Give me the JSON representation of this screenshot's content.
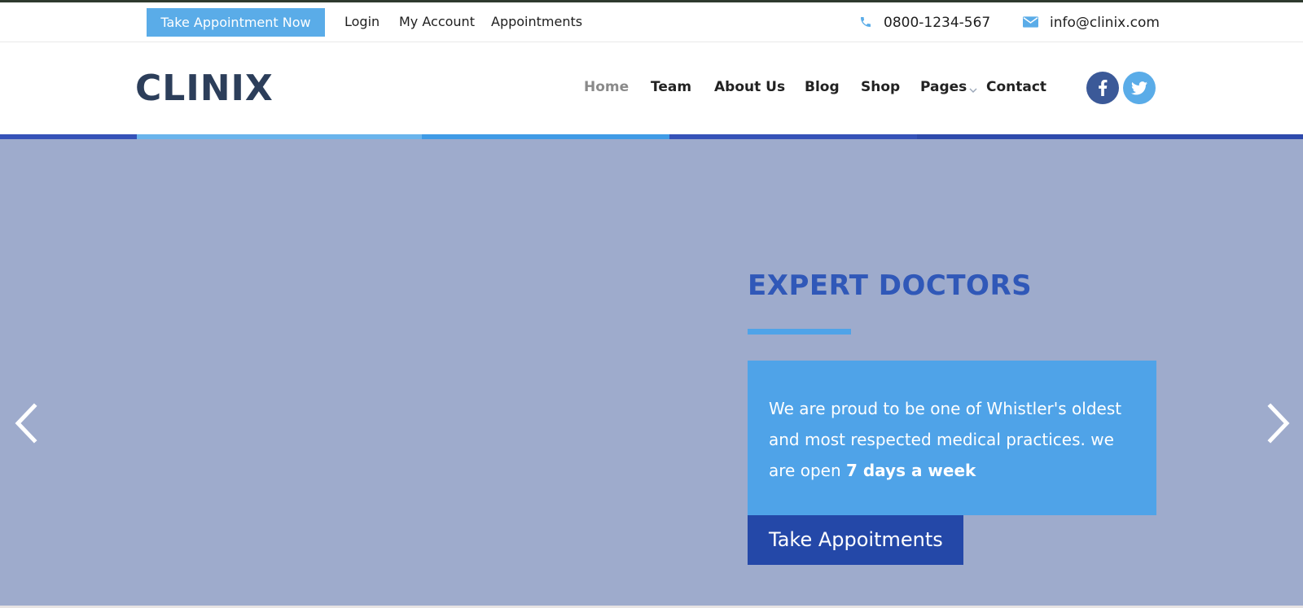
{
  "topbar": {
    "cta_label": "Take Appointment Now",
    "links": [
      "Login",
      "My Account",
      "Appointments"
    ],
    "phone": "0800-1234-567",
    "email": "info@clinix.com",
    "phone_icon": "phone-icon",
    "email_icon": "envelope-icon"
  },
  "header": {
    "logo": "CLINIX",
    "nav": [
      "Home",
      "Team",
      "About Us",
      "Blog",
      "Shop",
      "Pages",
      "Contact"
    ],
    "active_nav": "Home",
    "social": [
      "facebook-icon",
      "twitter-icon"
    ]
  },
  "hero": {
    "title": "EXPERT DOCTORS",
    "text_main": "We are proud to be one of Whistler's oldest and most respected medical practices. we are open ",
    "text_bold": "7 days a week",
    "cta_label": "Take Appoitments",
    "prev_icon": "chevron-left-icon",
    "next_icon": "chevron-right-icon"
  },
  "colors": {
    "accent_light": "#5aace8",
    "accent_blue": "#4fa3e8",
    "accent_dark": "#2448a8",
    "hero_bg": "#9eabcc",
    "title_blue": "#3058b8",
    "logo": "#2c3e5a",
    "facebook": "#3b5998"
  }
}
